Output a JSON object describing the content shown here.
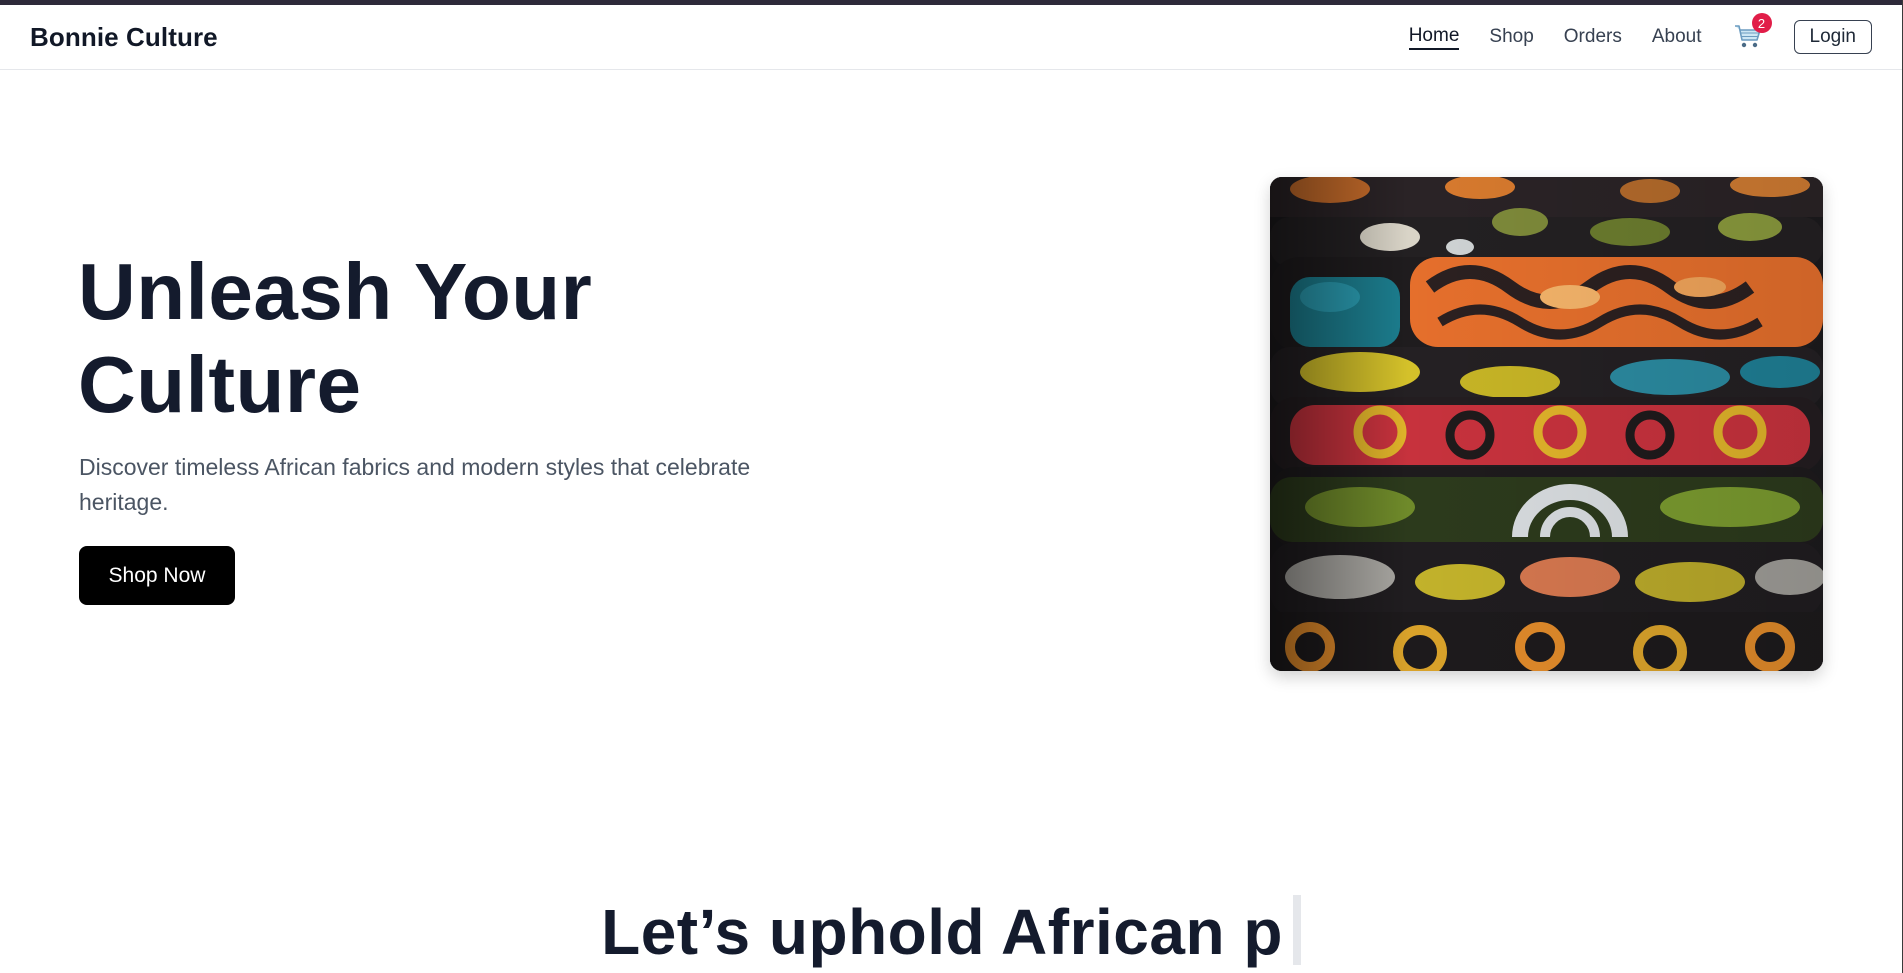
{
  "brand": "Bonnie Culture",
  "nav": {
    "links": [
      {
        "label": "Home",
        "active": true
      },
      {
        "label": "Shop",
        "active": false
      },
      {
        "label": "Orders",
        "active": false
      },
      {
        "label": "About",
        "active": false
      }
    ],
    "cart_icon": "shopping-cart-icon",
    "cart_count": "2",
    "login_label": "Login"
  },
  "hero": {
    "title_line1": "Unleash Your",
    "title_line2": "Culture",
    "subtitle": "Discover timeless African fabrics and modern styles that celebrate heritage.",
    "cta_label": "Shop Now"
  },
  "tagline": {
    "text": "Let’s uphold African p"
  },
  "colors": {
    "accent": "#000000",
    "badge": "#e11d48",
    "heading": "#141b2d"
  }
}
